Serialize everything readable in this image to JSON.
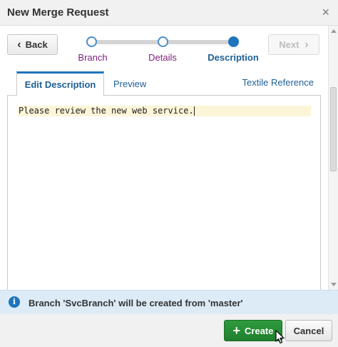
{
  "dialog": {
    "title": "New Merge Request",
    "close_glyph": "×"
  },
  "navigation": {
    "back_label": "Back",
    "back_glyph": "‹",
    "next_label": "Next",
    "next_glyph": "›",
    "next_enabled": false
  },
  "train": {
    "steps": [
      {
        "label": "Branch",
        "state": "visited"
      },
      {
        "label": "Details",
        "state": "visited"
      },
      {
        "label": "Description",
        "state": "current"
      }
    ]
  },
  "tabs": {
    "items": [
      {
        "label": "Edit Description",
        "selected": true
      },
      {
        "label": "Preview",
        "selected": false
      }
    ],
    "reference_link": "Textile Reference"
  },
  "editor": {
    "value": "Please review the new web service."
  },
  "info": {
    "icon": "i",
    "message": "Branch 'SvcBranch' will be created from 'master'"
  },
  "footer": {
    "create_label": "Create",
    "create_glyph": "+",
    "cancel_label": "Cancel"
  },
  "colors": {
    "accent": "#1d75bd",
    "visited_step": "#7b1f7b",
    "create_green": "#2f9b3f",
    "info_background": "#dcebf6"
  }
}
